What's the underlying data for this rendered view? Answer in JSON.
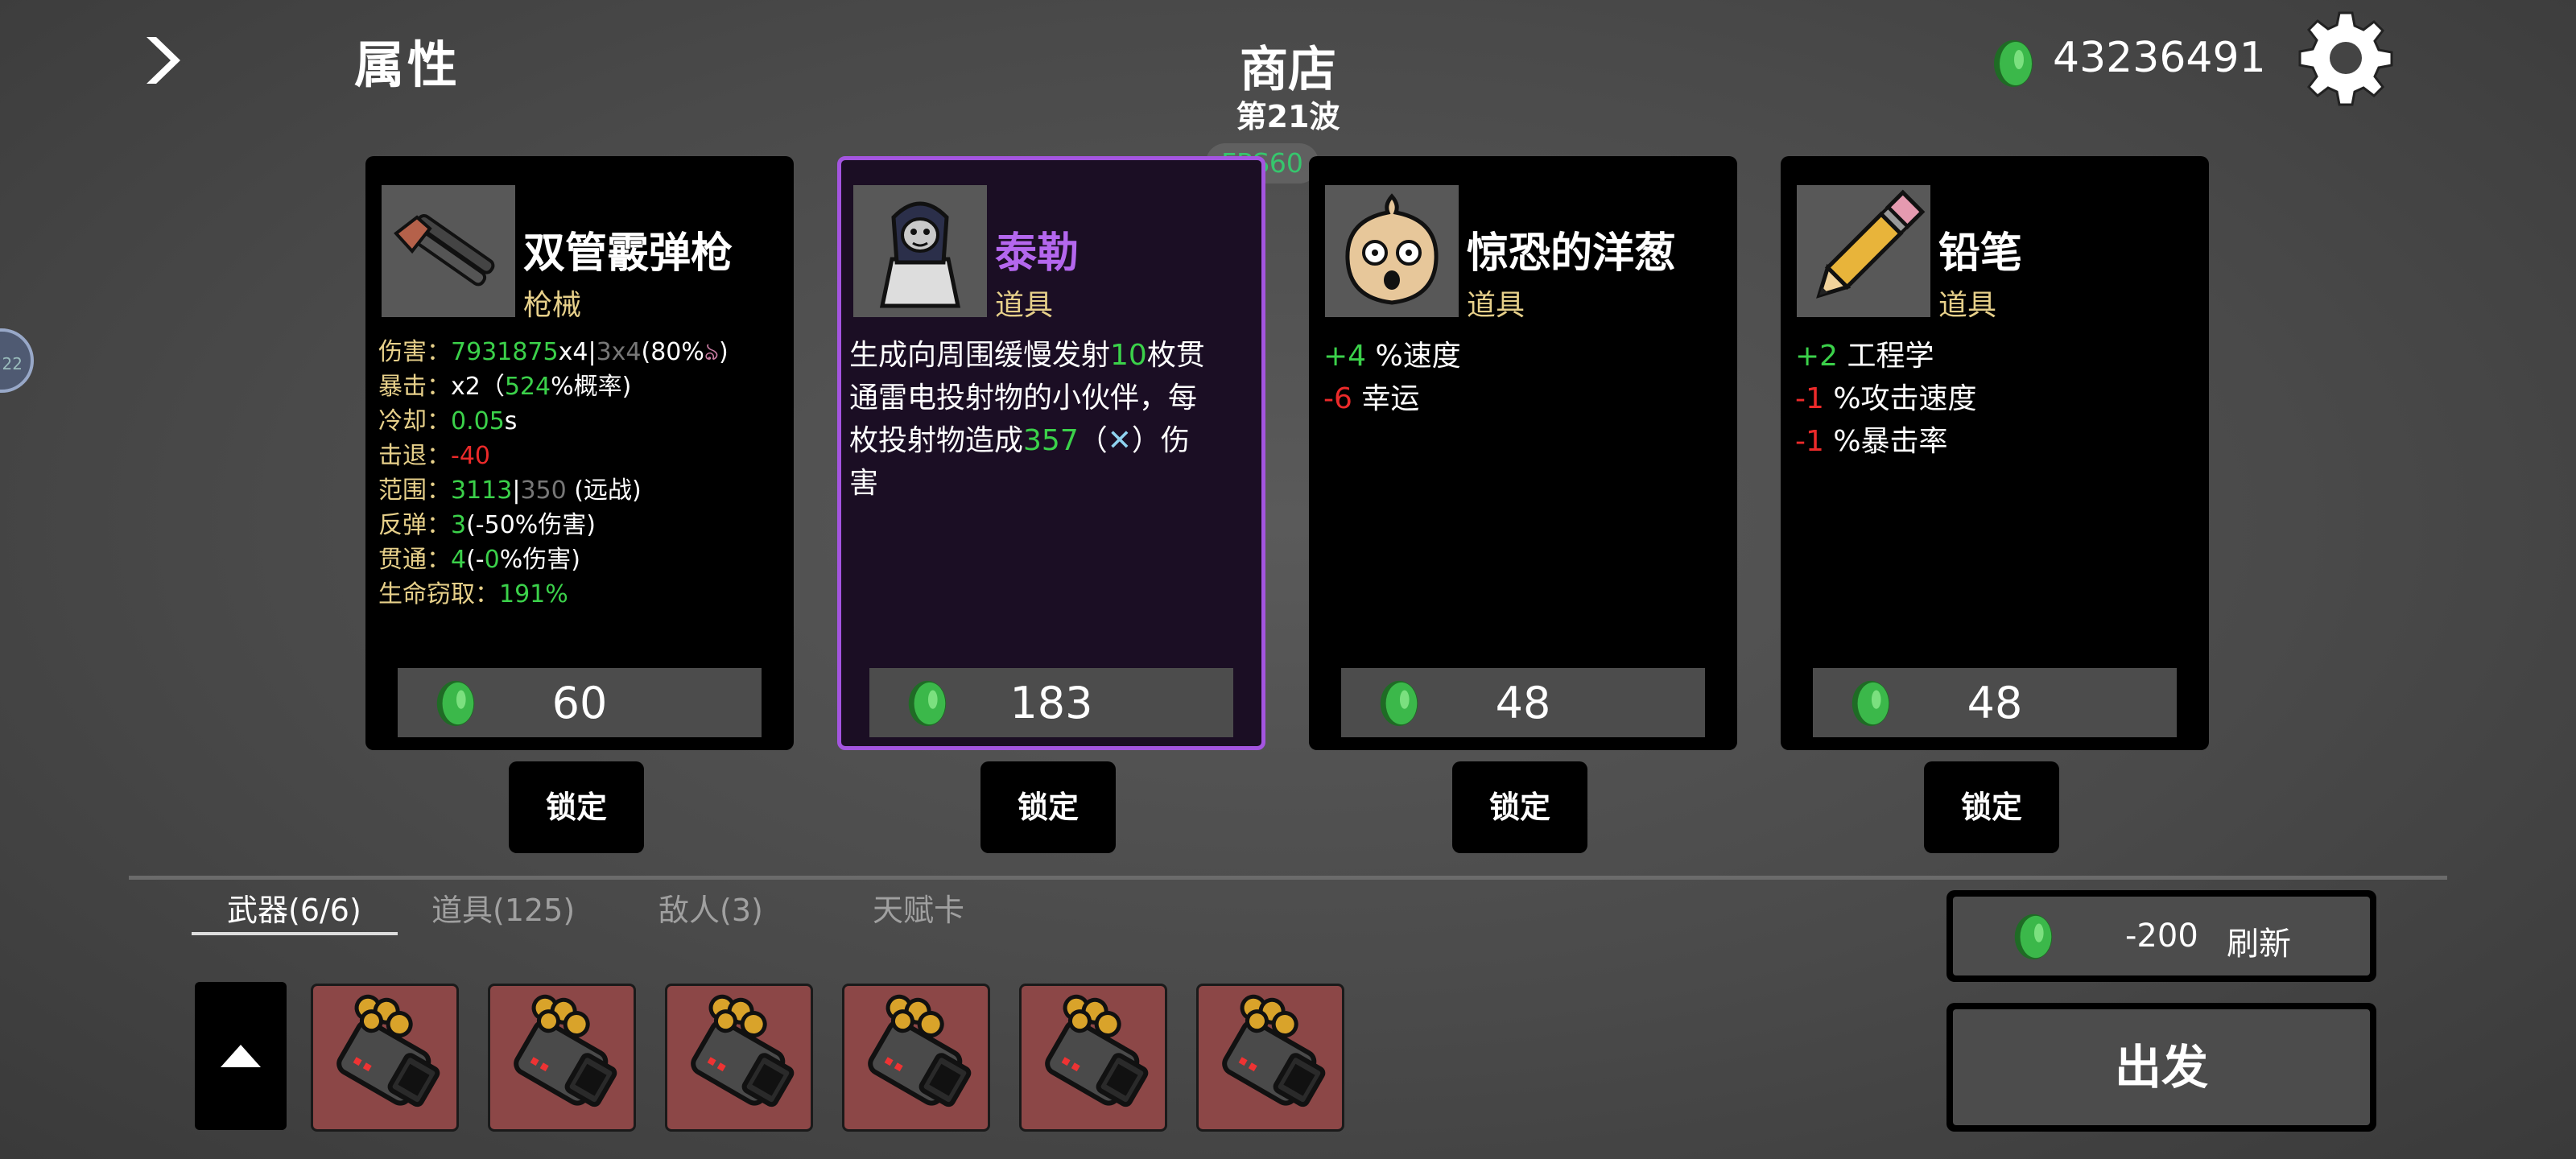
{
  "header": {
    "attributes_label": "属性",
    "shop_title": "商店",
    "wave_label": "第21波",
    "fps_label": "FPS60",
    "money": "43236491"
  },
  "side_badge": "22",
  "cards": [
    {
      "name": "双管霰弹枪",
      "type": "枪械",
      "name_color": "#ffffff",
      "icon": "double-barrel-shotgun-icon",
      "stats": {
        "damage_label": "伤害：",
        "damage_value": "7931875",
        "damage_mult": "x4",
        "damage_sep": "|",
        "damage_base": "3x4",
        "damage_extra": "(80%",
        "crit_label": "暴击：",
        "crit_mult": "x2（",
        "crit_chance": "524",
        "crit_suffix": "%概率)",
        "cooldown_label": "冷却：",
        "cooldown_value": "0.05",
        "cooldown_unit": "s",
        "knockback_label": "击退：",
        "knockback_value": "-40",
        "range_label": "范围：",
        "range_value": "3113",
        "range_sep": "|",
        "range_base": "350",
        "range_suffix": " (远战)",
        "bounce_label": "反弹：",
        "bounce_value": "3",
        "bounce_suffix": "(-50%伤害)",
        "pierce_label": "贯通：",
        "pierce_value": "4",
        "pierce_mid": "(-",
        "pierce_pct": "0",
        "pierce_suffix": "%伤害)",
        "lifesteal_label": "生命窃取：",
        "lifesteal_value": "191%"
      },
      "price": "60",
      "lock_label": "锁定"
    },
    {
      "name": "泰勒",
      "type": "道具",
      "name_color": "#b467ee",
      "icon": "hooded-figure-icon",
      "desc": {
        "line1_a": "生成向周围缓慢发射",
        "line1_num": "10",
        "line1_b": "枚贯",
        "line2": "通雷电投射物的小伙伴，每",
        "line3_a": "枚投射物造成",
        "line3_num": "357",
        "line3_b": "（",
        "line3_c": "）伤",
        "line4": "害"
      },
      "price": "183",
      "lock_label": "锁定"
    },
    {
      "name": "惊恐的洋葱",
      "type": "道具",
      "name_color": "#ffffff",
      "icon": "scared-onion-icon",
      "effects": [
        {
          "value": "+4",
          "text": " %速度",
          "color": "#3bd14a"
        },
        {
          "value": "-6",
          "text": " 幸运",
          "color": "#ec2a2a"
        }
      ],
      "price": "48",
      "lock_label": "锁定"
    },
    {
      "name": "铅笔",
      "type": "道具",
      "name_color": "#ffffff",
      "icon": "pencil-icon",
      "effects": [
        {
          "value": "+2",
          "text": " 工程学",
          "color": "#3bd14a"
        },
        {
          "value": "-1",
          "text": " %攻击速度",
          "color": "#ec2a2a"
        },
        {
          "value": "-1",
          "text": " %暴击率",
          "color": "#ec2a2a"
        }
      ],
      "price": "48",
      "lock_label": "锁定"
    }
  ],
  "tabs": [
    {
      "label": "武器(6/6)",
      "active": true
    },
    {
      "label": "道具(125)",
      "active": false
    },
    {
      "label": "敌人(3)",
      "active": false
    },
    {
      "label": "天赋卡",
      "active": false
    }
  ],
  "weapon_slots": [
    "gatling-gun-icon",
    "gatling-gun-icon",
    "gatling-gun-icon",
    "gatling-gun-icon",
    "gatling-gun-icon",
    "gatling-gun-icon"
  ],
  "refresh": {
    "cost": "-200",
    "label": "刷新"
  },
  "go_label": "出发",
  "colors": {
    "positive": "#3bd14a",
    "negative": "#ec2a2a",
    "selected_border": "#a455e0",
    "coin": "#3bb84a"
  }
}
